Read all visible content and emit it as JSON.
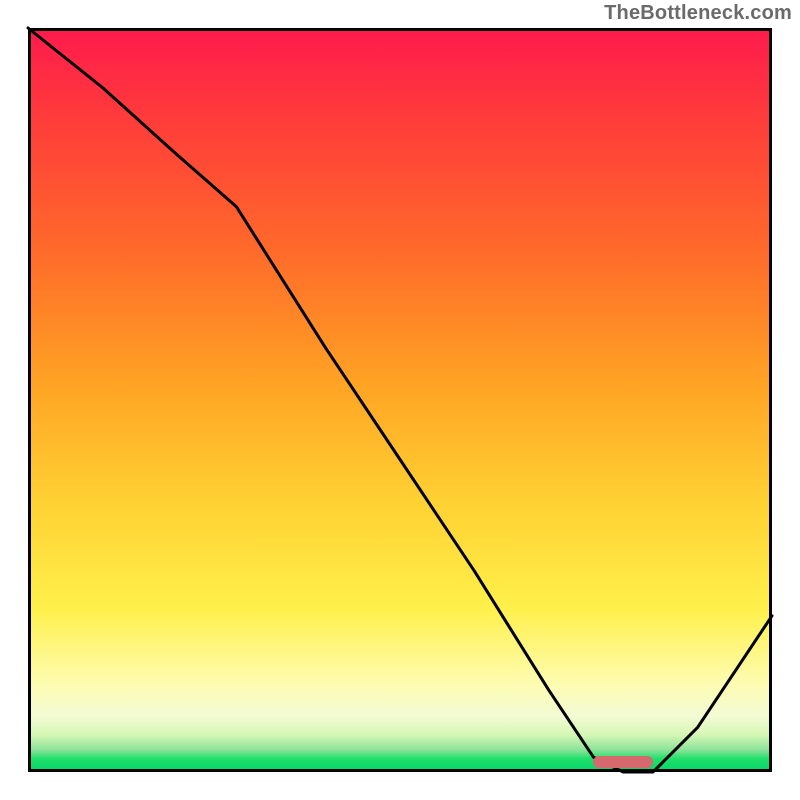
{
  "watermark": "TheBottleneck.com",
  "colors": {
    "gradient_top": "#ff1a4d",
    "gradient_bottom": "#00d66a",
    "curve": "#000000",
    "marker": "#d5696d",
    "border": "#000000"
  },
  "chart_data": {
    "type": "line",
    "title": "",
    "xlabel": "",
    "ylabel": "",
    "xlim": [
      0,
      100
    ],
    "ylim": [
      0,
      100
    ],
    "note": "No axis tick labels are shown in the image; x and y are normalized 0–100. y=100 is the top (red / high bottleneck), y=0 is the bottom (green / optimal).",
    "series": [
      {
        "name": "bottleneck-curve",
        "x": [
          0,
          10,
          20,
          28,
          40,
          50,
          60,
          70,
          76,
          80,
          84,
          90,
          100
        ],
        "y": [
          100,
          92,
          83,
          76,
          57,
          42,
          27,
          11,
          2,
          0,
          0,
          6,
          21
        ]
      }
    ],
    "marker": {
      "name": "selected-range",
      "x_start": 76,
      "x_end": 84,
      "y": 0
    }
  }
}
